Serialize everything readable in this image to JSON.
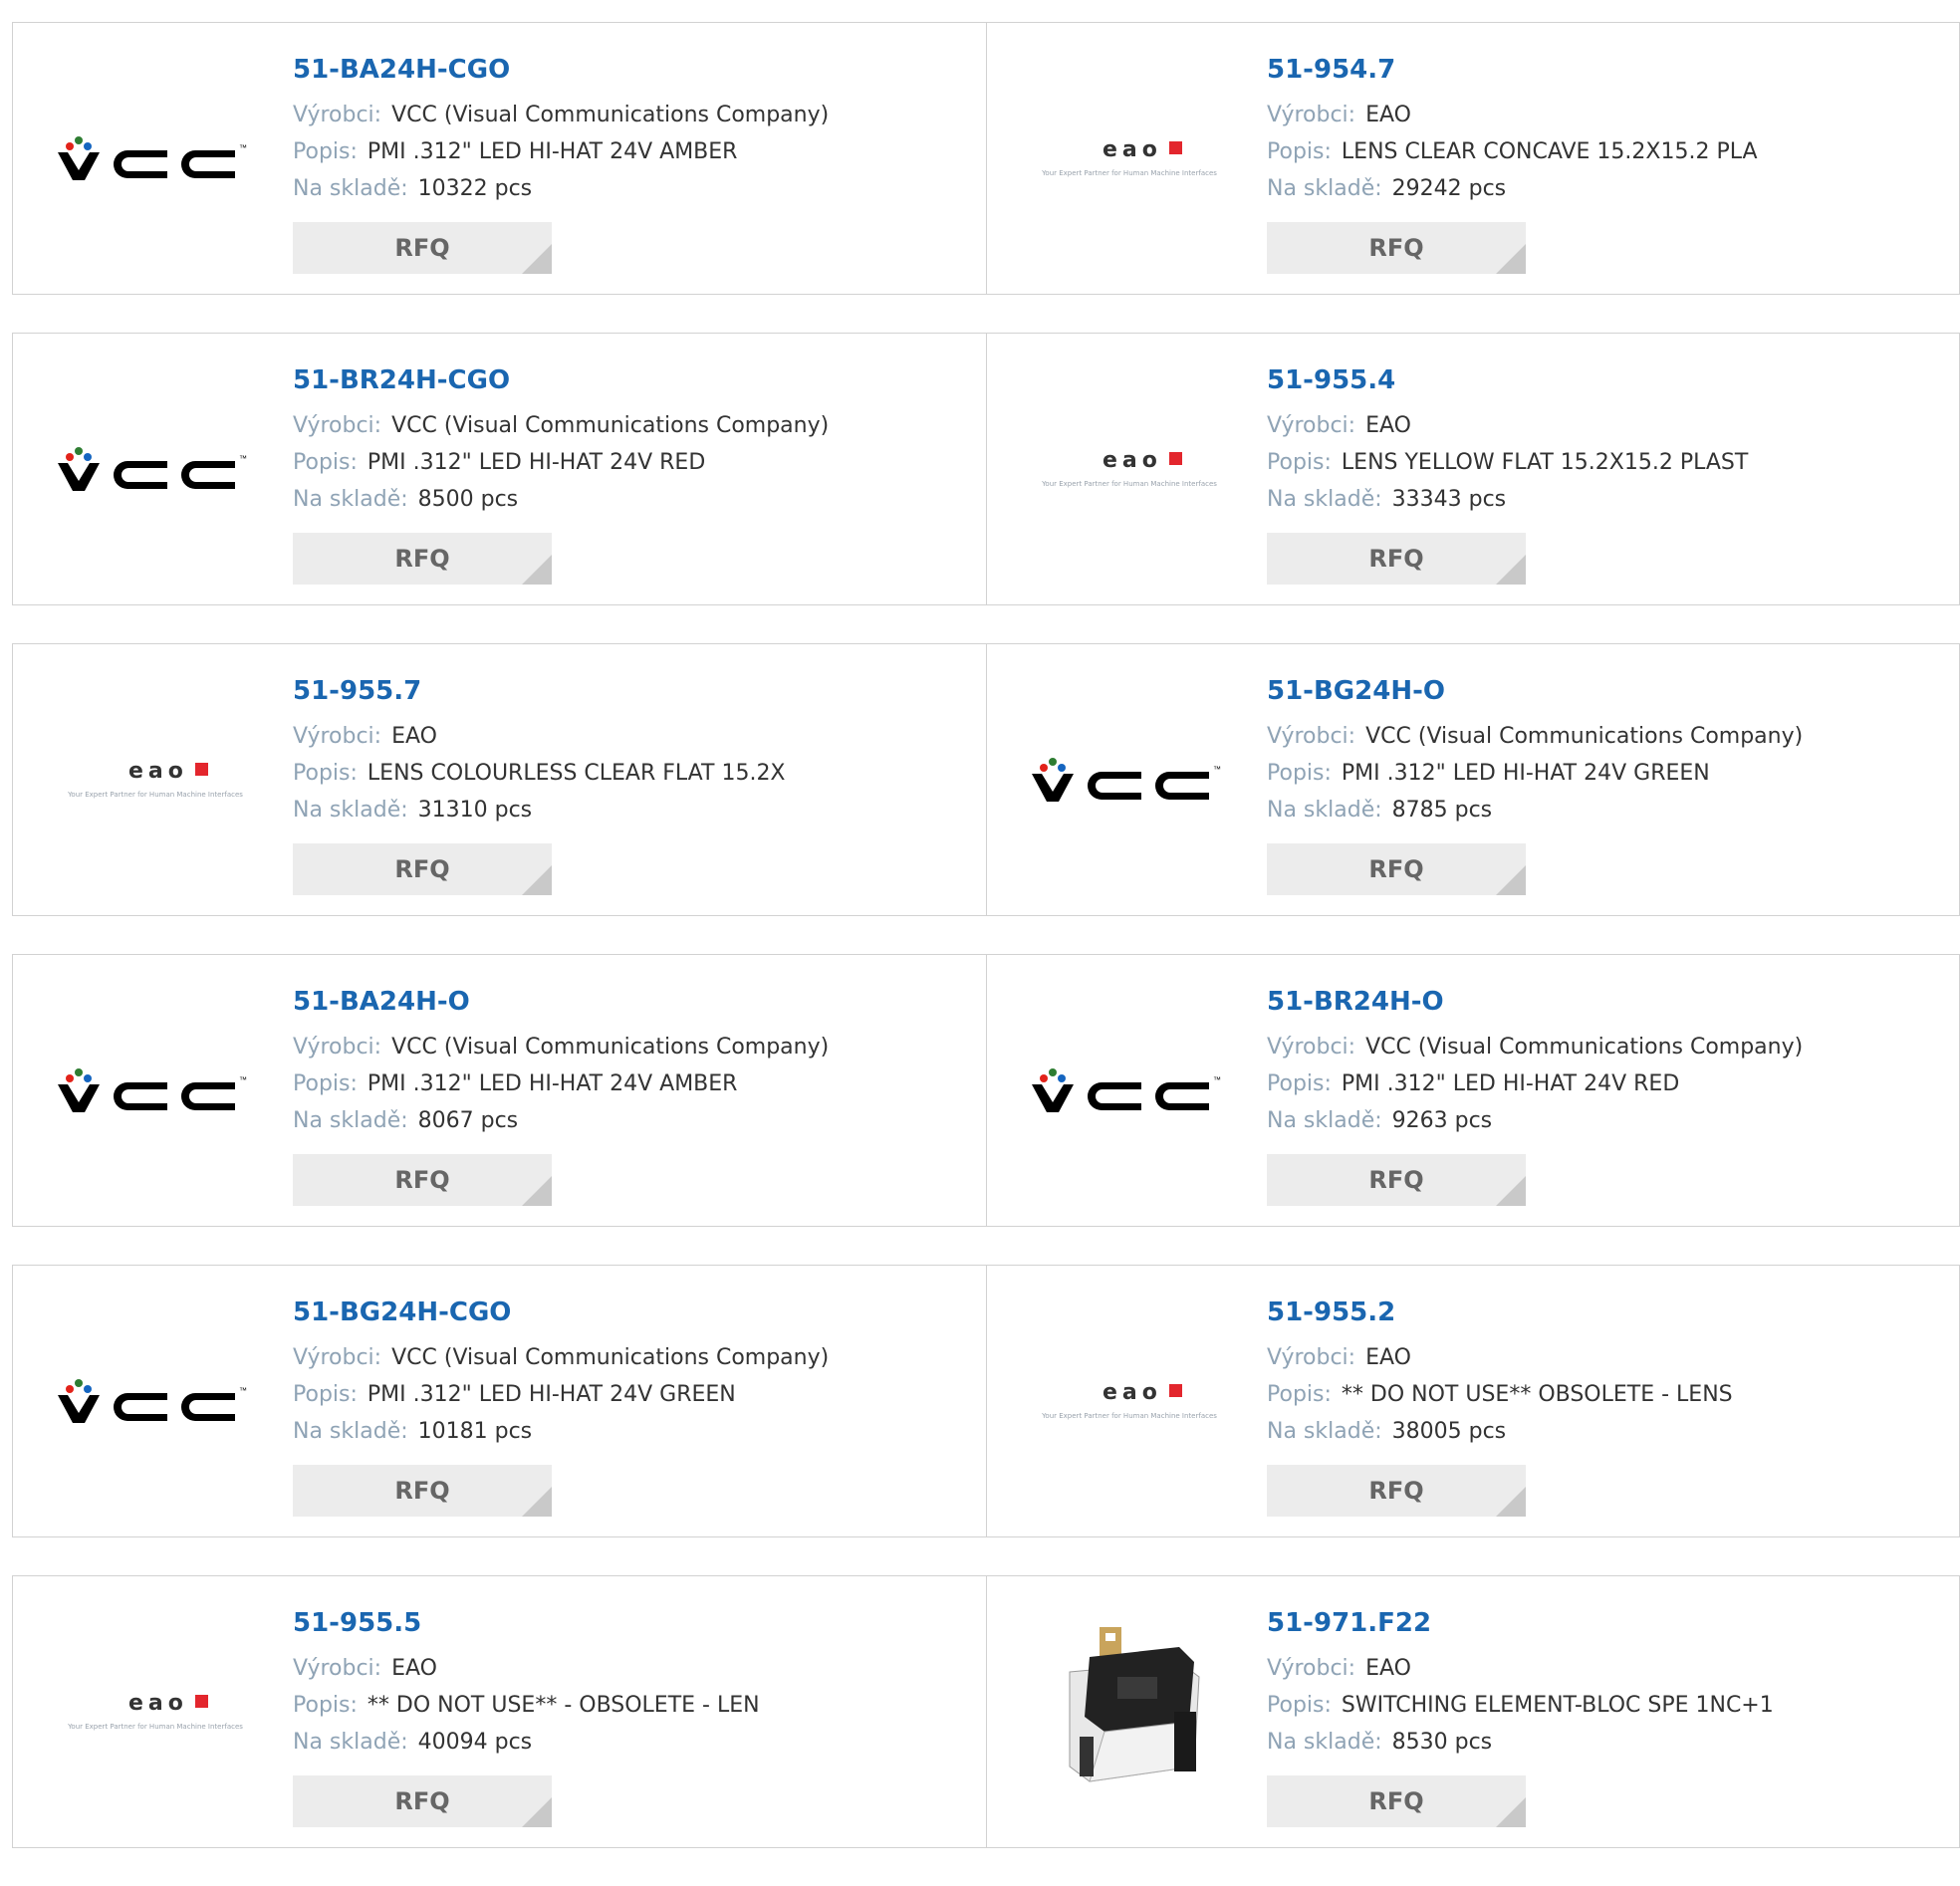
{
  "labels": {
    "manufacturer": "Výrobci:",
    "description": "Popis:",
    "stock": "Na skladě:",
    "rfq": "RFQ"
  },
  "eao_logo": {
    "wordmark": "eao",
    "tagline": "Your Expert Partner for Human Machine Interfaces",
    "accent": "#e3262d"
  },
  "vcc_logo": {
    "wordmark": "VCC",
    "trademark": "™"
  },
  "products": [
    {
      "pn": "51-BA24H-CGO",
      "logo": "vcc",
      "manufacturer": "VCC (Visual Communications Company)",
      "description": "PMI .312\" LED HI-HAT 24V AMBER",
      "stock": "10322 pcs"
    },
    {
      "pn": "51-954.7",
      "logo": "eao",
      "manufacturer": "EAO",
      "description": "LENS CLEAR CONCAVE 15.2X15.2 PLA",
      "stock": "29242 pcs"
    },
    {
      "pn": "51-BR24H-CGO",
      "logo": "vcc",
      "manufacturer": "VCC (Visual Communications Company)",
      "description": "PMI .312\" LED HI-HAT 24V RED",
      "stock": "8500 pcs"
    },
    {
      "pn": "51-955.4",
      "logo": "eao",
      "manufacturer": "EAO",
      "description": "LENS YELLOW FLAT 15.2X15.2 PLAST",
      "stock": "33343 pcs"
    },
    {
      "pn": "51-955.7",
      "logo": "eao",
      "manufacturer": "EAO",
      "description": "LENS COLOURLESS CLEAR FLAT 15.2X",
      "stock": "31310 pcs"
    },
    {
      "pn": "51-BG24H-O",
      "logo": "vcc",
      "manufacturer": "VCC (Visual Communications Company)",
      "description": "PMI .312\" LED HI-HAT 24V GREEN",
      "stock": "8785 pcs"
    },
    {
      "pn": "51-BA24H-O",
      "logo": "vcc",
      "manufacturer": "VCC (Visual Communications Company)",
      "description": "PMI .312\" LED HI-HAT 24V AMBER",
      "stock": "8067 pcs"
    },
    {
      "pn": "51-BR24H-O",
      "logo": "vcc",
      "manufacturer": "VCC (Visual Communications Company)",
      "description": "PMI .312\" LED HI-HAT 24V RED",
      "stock": "9263 pcs"
    },
    {
      "pn": "51-BG24H-CGO",
      "logo": "vcc",
      "manufacturer": "VCC (Visual Communications Company)",
      "description": "PMI .312\" LED HI-HAT 24V GREEN",
      "stock": "10181 pcs"
    },
    {
      "pn": "51-955.2",
      "logo": "eao",
      "manufacturer": "EAO",
      "description": "** DO NOT USE** OBSOLETE - LENS",
      "stock": "38005 pcs"
    },
    {
      "pn": "51-955.5",
      "logo": "eao",
      "manufacturer": "EAO",
      "description": "** DO NOT USE** - OBSOLETE - LEN",
      "stock": "40094 pcs"
    },
    {
      "pn": "51-971.F22",
      "logo": "switch",
      "manufacturer": "EAO",
      "description": "SWITCHING ELEMENT-BLOC SPE 1NC+1",
      "stock": "8530 pcs"
    }
  ]
}
